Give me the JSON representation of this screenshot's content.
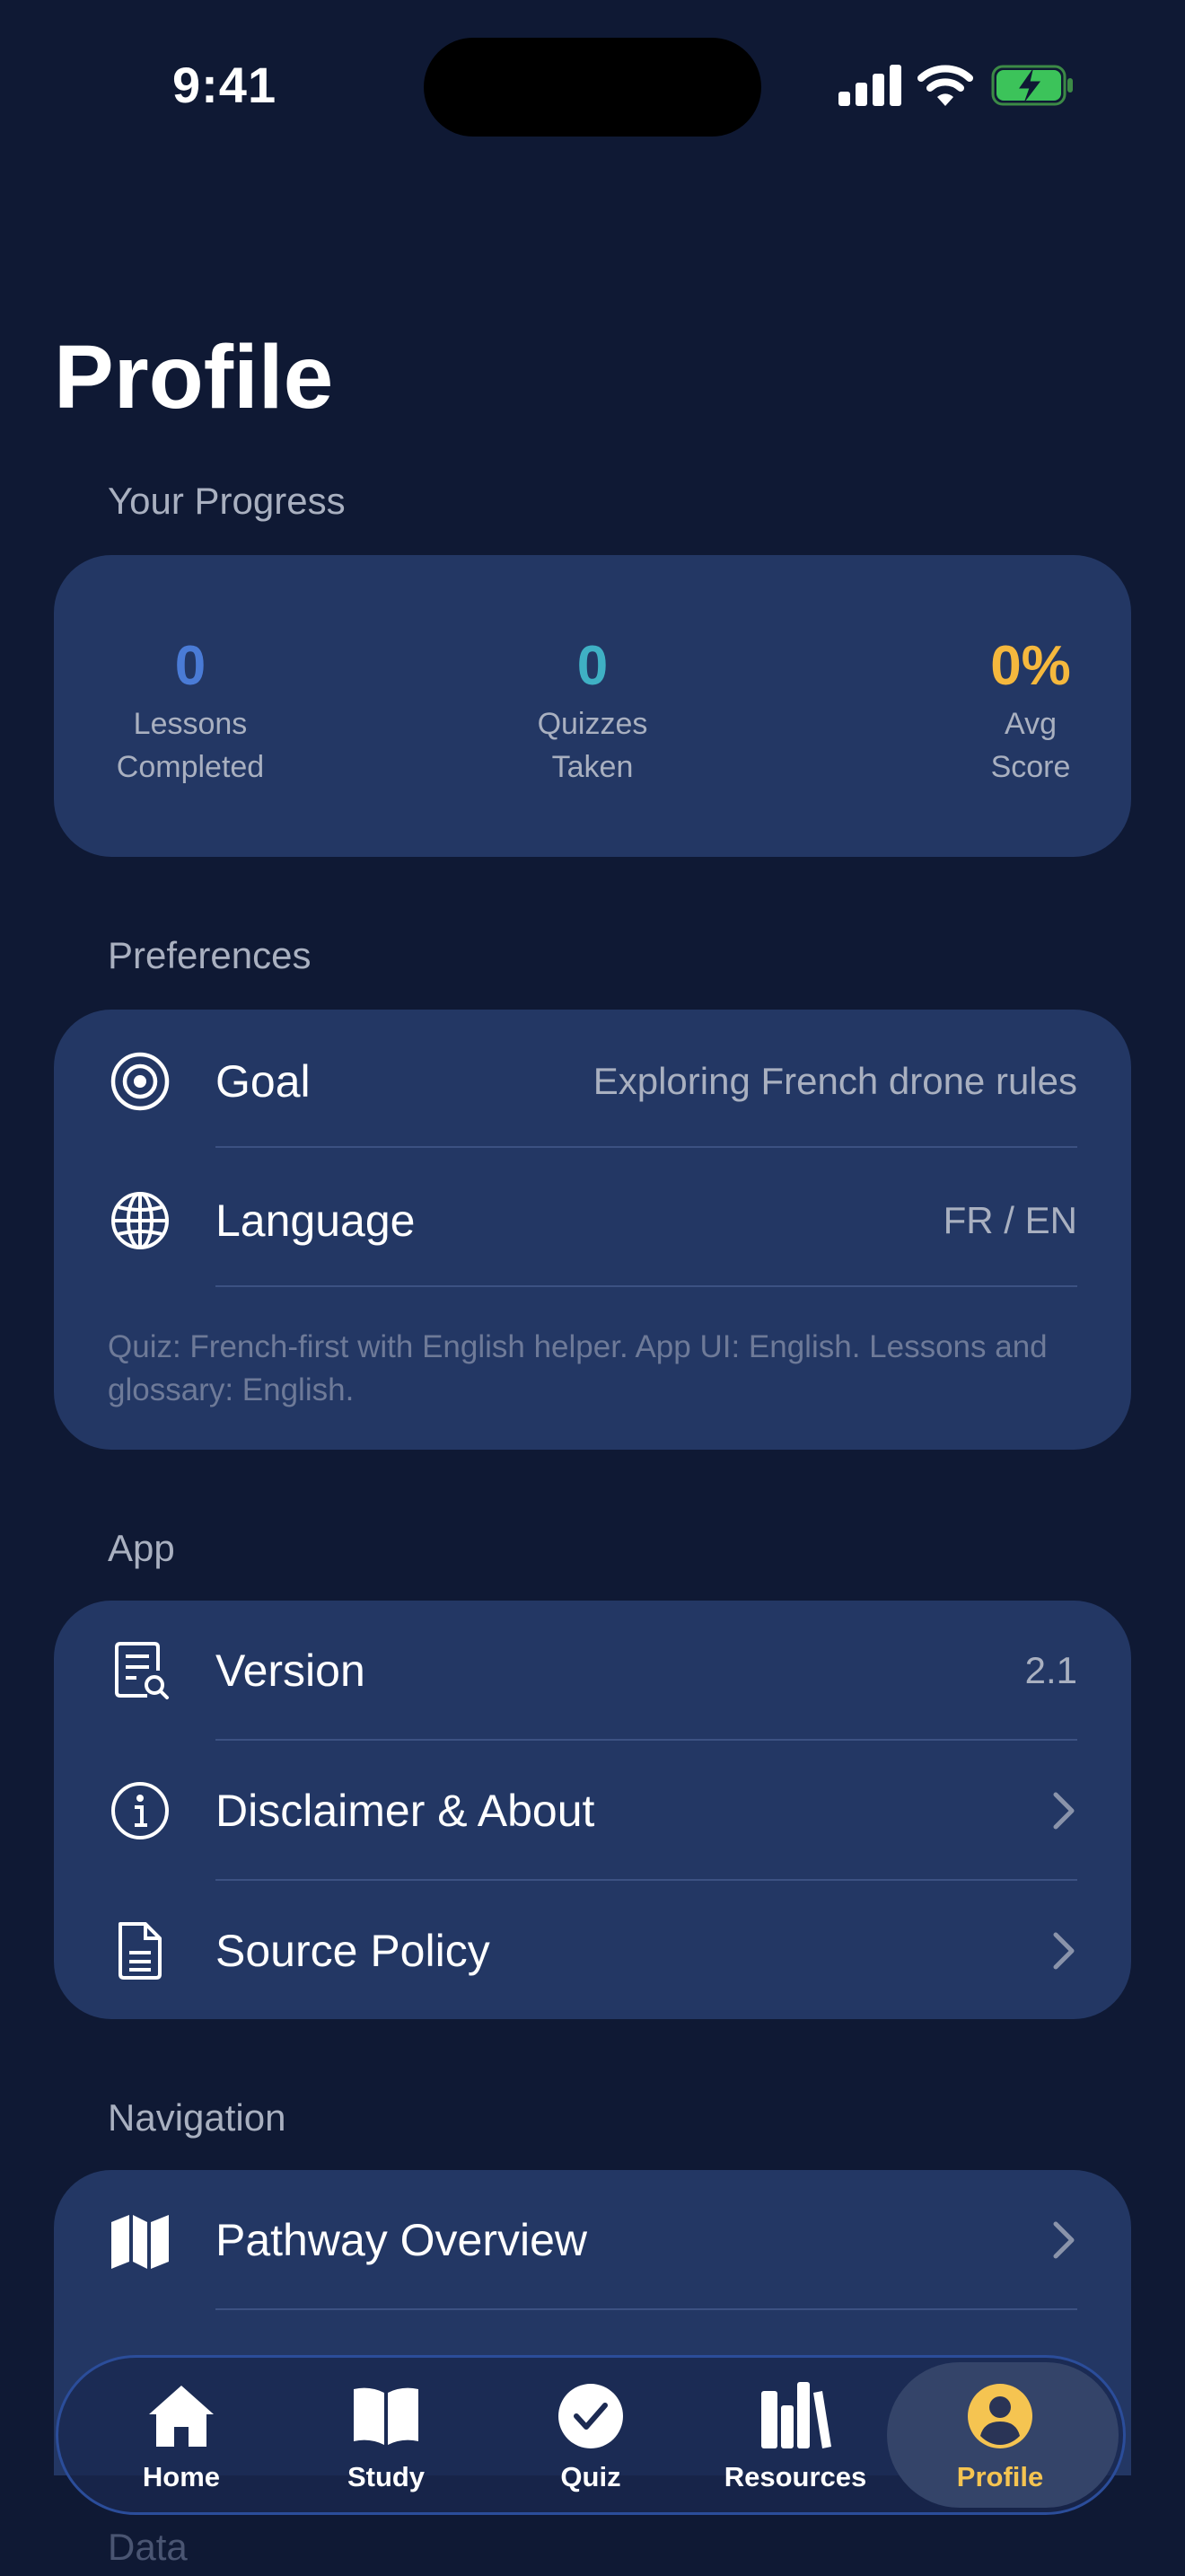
{
  "status_bar": {
    "time": "9:41"
  },
  "page": {
    "title": "Profile"
  },
  "progress": {
    "label": "Your Progress",
    "stats": [
      {
        "value": "0",
        "label": "Lessons\nCompleted",
        "color": "#4a7bd6"
      },
      {
        "value": "0",
        "label": "Quizzes\nTaken",
        "color": "#3fb0c4"
      },
      {
        "value": "0%",
        "label": "Avg\nScore",
        "color": "#f5b83d"
      }
    ]
  },
  "preferences": {
    "label": "Preferences",
    "goal": {
      "title": "Goal",
      "value": "Exploring French drone rules",
      "icon": "target-icon"
    },
    "language": {
      "title": "Language",
      "value": "FR / EN",
      "icon": "globe-icon"
    },
    "note": "Quiz: French-first with English helper. App UI: English. Lessons and glossary: English."
  },
  "app": {
    "label": "App",
    "version": {
      "title": "Version",
      "value": "2.1",
      "icon": "document-search-icon"
    },
    "disclaimer": {
      "title": "Disclaimer & About",
      "icon": "info-icon"
    },
    "source_policy": {
      "title": "Source Policy",
      "icon": "document-icon"
    }
  },
  "navigation": {
    "label": "Navigation",
    "pathway": {
      "title": "Pathway Overview",
      "icon": "map-icon"
    }
  },
  "data_section": {
    "label": "Data"
  },
  "tabbar": {
    "tabs": [
      {
        "label": "Home",
        "icon": "house-icon"
      },
      {
        "label": "Study",
        "icon": "book-icon"
      },
      {
        "label": "Quiz",
        "icon": "checkmark-circle-icon"
      },
      {
        "label": "Resources",
        "icon": "books-icon"
      },
      {
        "label": "Profile",
        "icon": "person-circle-icon",
        "active": true
      }
    ]
  },
  "colors": {
    "background": "#0f1934",
    "card": "#233764",
    "accent": "#f5c451"
  }
}
